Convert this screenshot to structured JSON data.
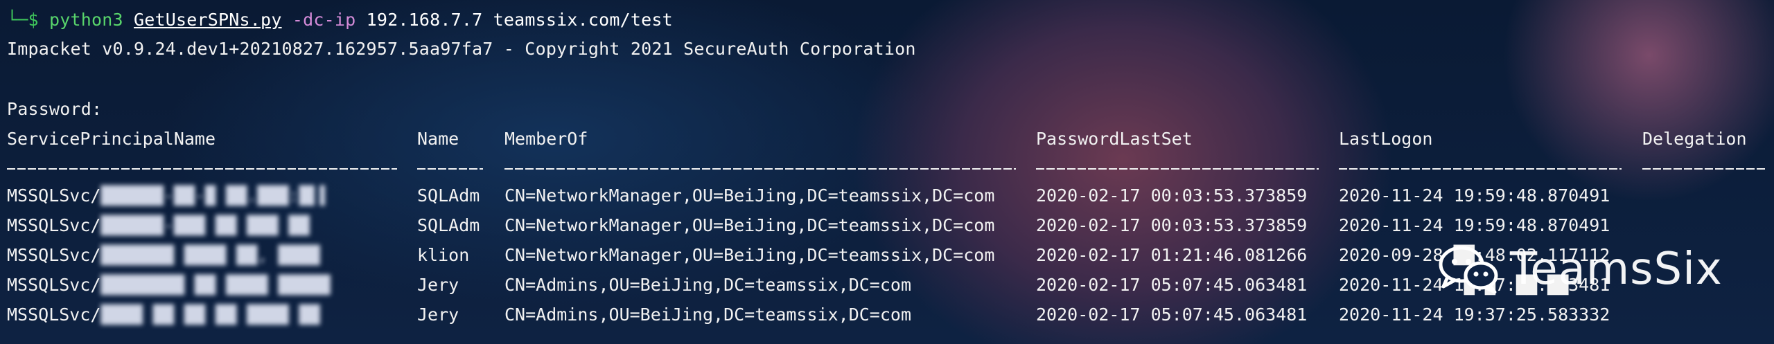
{
  "prompt": {
    "prefix": "└─$ ",
    "command": "python3",
    "script": "GetUserSPNs.py",
    "flag": "-dc-ip",
    "args": "192.168.7.7 teamssix.com/test"
  },
  "banner": "Impacket v0.9.24.dev1+20210827.162957.5aa97fa7 - Copyright 2021 SecureAuth Corporation",
  "password_prompt": "Password:",
  "headers": [
    "ServicePrincipalName",
    "Name",
    "MemberOf",
    "PasswordLastSet",
    "LastLogon",
    "Delegation"
  ],
  "rows": [
    {
      "spn_prefix": "MSSQLSvc/",
      "spn_hidden": "██████-██-█ ██.███:█▌▌",
      "name": "SQLAdm",
      "memberof": "CN=NetworkManager,OU=BeiJing,DC=teamssix,DC=com",
      "pwdlastset": "2020-02-17 00:03:53.373859",
      "lastlogon": "2020-11-24 19:59:48.870491"
    },
    {
      "spn_prefix": "MSSQLSvc/",
      "spn_hidden": "██████-███ ██ ███ ██",
      "name": "SQLAdm",
      "memberof": "CN=NetworkManager,OU=BeiJing,DC=teamssix,DC=com",
      "pwdlastset": "2020-02-17 00:03:53.373859",
      "lastlogon": "2020-11-24 19:59:48.870491"
    },
    {
      "spn_prefix": "MSSQLSvc/",
      "spn_hidden": "███████ ████ ██, ████",
      "name": "klion",
      "memberof": "CN=NetworkManager,OU=BeiJing,DC=teamssix,DC=com",
      "pwdlastset": "2020-02-17 01:21:46.081266",
      "lastlogon": "2020-09-28 ██:48:02.117112"
    },
    {
      "spn_prefix": "MSSQLSvc/",
      "spn_hidden": "████████ ██ ████ █████",
      "name": "Jery",
      "memberof": "CN=Admins,OU=BeiJing,DC=teamssix,DC=com",
      "pwdlastset": "2020-02-17 05:07:45.063481",
      "lastlogon": "2020-11-24 1█:█7:██.██3481"
    },
    {
      "spn_prefix": "MSSQLSvc/",
      "spn_hidden": "████ ██ ██ ██ ████ ██",
      "name": "Jery",
      "memberof": "CN=Admins,OU=BeiJing,DC=teamssix,DC=com",
      "pwdlastset": "2020-02-17 05:07:45.063481",
      "lastlogon": "2020-11-24 19:37:25.583332"
    }
  ],
  "watermark": "TeamsSix",
  "icon": "wechat-icon"
}
